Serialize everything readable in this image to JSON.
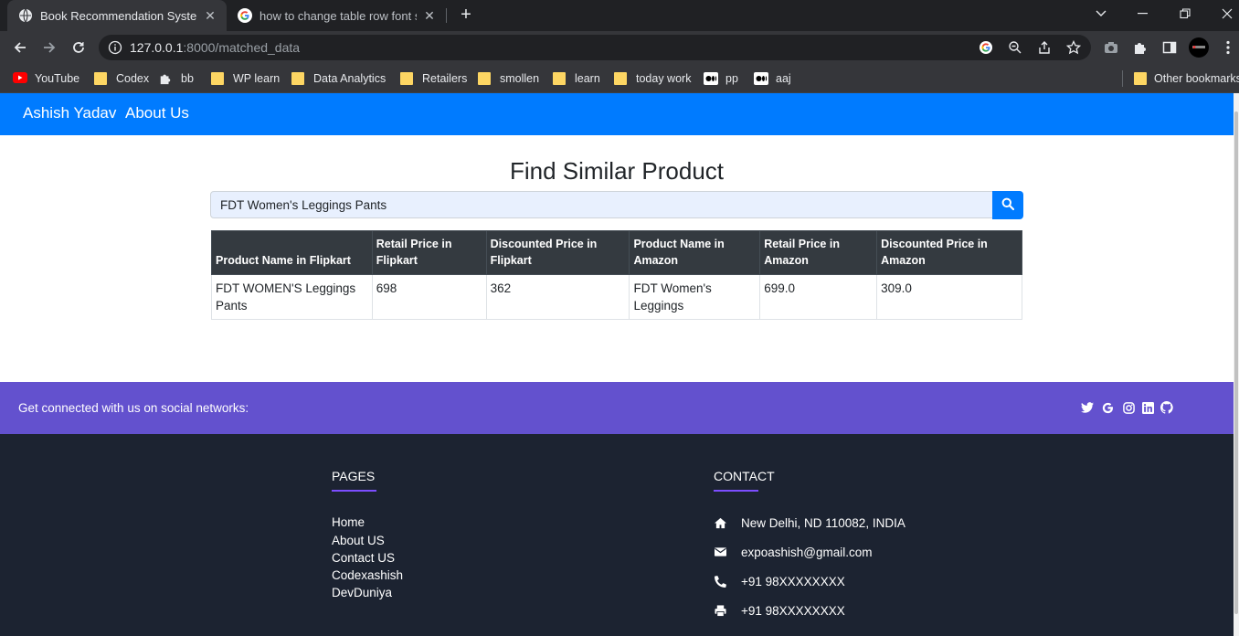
{
  "browser": {
    "tabs": [
      {
        "title": "Book Recommendation System",
        "active": true
      },
      {
        "title": "how to change table row font size",
        "active": false
      }
    ],
    "url": {
      "host": "127.0.0.1",
      "path": ":8000/matched_data"
    },
    "bookmarks": [
      {
        "label": "YouTube",
        "icon": "youtube-icon"
      },
      {
        "label": "Codex",
        "icon": "folder-icon"
      },
      {
        "label": "bb",
        "icon": "puzzle-icon"
      },
      {
        "label": "WP learn",
        "icon": "folder-icon"
      },
      {
        "label": "Data Analytics",
        "icon": "folder-icon"
      },
      {
        "label": "Retailers",
        "icon": "folder-icon"
      },
      {
        "label": "smollen",
        "icon": "folder-icon"
      },
      {
        "label": "learn",
        "icon": "folder-icon"
      },
      {
        "label": "today work",
        "icon": "folder-icon"
      },
      {
        "label": "pp",
        "icon": "medium-icon"
      },
      {
        "label": "aaj",
        "icon": "medium-icon"
      }
    ],
    "other_bookmarks": "Other bookmarks"
  },
  "navbar": {
    "brand": "Ashish Yadav",
    "link": "About Us"
  },
  "main": {
    "heading": "Find Similar Product",
    "search_value": "FDT Women's Leggings Pants"
  },
  "table": {
    "headers": [
      "Product Name in Flipkart",
      "Retail Price in Flipkart",
      "Discounted Price in Flipkart",
      "Product Name in Amazon",
      "Retail Price in Amazon",
      "Discounted Price in Amazon"
    ],
    "rows": [
      [
        "FDT WOMEN'S Leggings Pants",
        "698",
        "362",
        "FDT Women's Leggings",
        "699.0",
        "309.0"
      ]
    ]
  },
  "social": {
    "text": "Get connected with us on social networks:",
    "icons": [
      "twitter-icon",
      "google-icon",
      "instagram-icon",
      "linkedin-icon",
      "github-icon"
    ]
  },
  "footer": {
    "pages_heading": "PAGES",
    "pages": [
      "Home",
      "About US",
      "Contact US",
      "Codexashish",
      "DevDuniya"
    ],
    "contact_heading": "CONTACT",
    "contact": {
      "address": "New Delhi, ND 110082, INDIA",
      "email": "expoashish@gmail.com",
      "phone": "+91 98XXXXXXXX",
      "fax": "+91 98XXXXXXXX"
    }
  },
  "colors": {
    "primary": "#007bff",
    "social_bar": "#6351ce",
    "footer_bg": "#1c2331",
    "table_head": "#343a40",
    "accent_line": "#7c4dff"
  }
}
